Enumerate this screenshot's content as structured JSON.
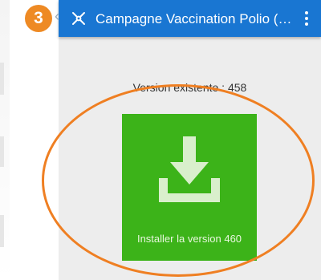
{
  "step_badge": "3",
  "appbar": {
    "title": "Campagne Vaccination Polio (Stag...",
    "app_icon": "polio-logo-icon",
    "menu_icon": "overflow-menu-icon"
  },
  "content": {
    "version_label": "Version existente : 458",
    "install_button_label": "Installer la version 460",
    "install_icon": "download-icon"
  },
  "colors": {
    "appbar": "#1976d2",
    "install_button": "#3cb319",
    "background": "#ededed",
    "annotation": "#ef7f22"
  }
}
